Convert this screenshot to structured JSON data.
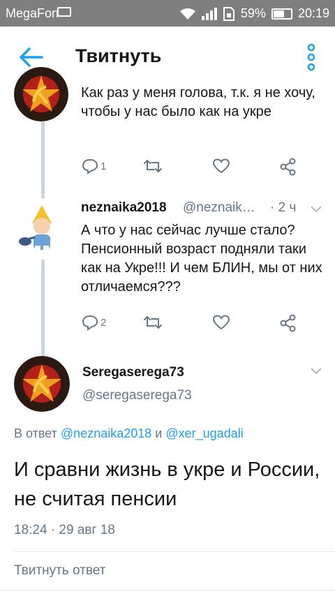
{
  "status_bar": {
    "carrier": "MegaFon",
    "battery": "59%",
    "time": "20:19"
  },
  "header": {
    "title": "Твитнуть"
  },
  "colors": {
    "accent": "#1da1f2",
    "secondary_text": "#657786",
    "thread_line": "#ccd6dd"
  },
  "thread": [
    {
      "text": "Как  раз у меня голова, т.к. я не хочу, чтобы у нас было как на укре",
      "reply_count": "1"
    },
    {
      "display_name": "neznaika2018",
      "handle": "@neznaik…",
      "time": "· 2 ч",
      "text": "А что у нас сейчас лучше стало? Пенсионный возраст подняли таки как на Укре!!! И чем БЛИН, мы от них отличаемся???",
      "reply_count": "2"
    }
  ],
  "focused_tweet": {
    "display_name": "Seregaserega73",
    "handle": "@seregaserega73",
    "reply_prefix": "В ответ",
    "mention_1": "@neznaika2018",
    "conjunction": "и",
    "mention_2": "@xer_ugadali",
    "text": "И сравни жизнь в укре и России, не считая пенсии",
    "timestamp": "18:24 · 29 авг 18"
  },
  "reply_box": {
    "placeholder": "Твитнуть ответ"
  }
}
